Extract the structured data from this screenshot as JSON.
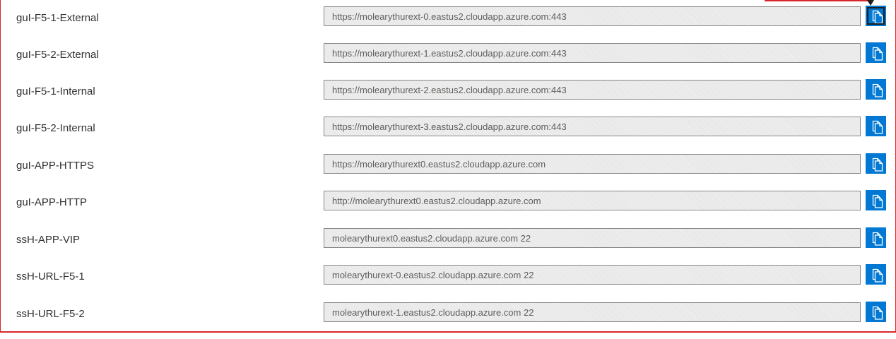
{
  "rows": [
    {
      "label": "guI-F5-1-External",
      "value": "https://molearythurext-0.eastus2.cloudapp.azure.com:443",
      "copy_icon": "copy-icon"
    },
    {
      "label": "guI-F5-2-External",
      "value": "https://molearythurext-1.eastus2.cloudapp.azure.com:443",
      "copy_icon": "copy-icon"
    },
    {
      "label": "guI-F5-1-Internal",
      "value": "https://molearythurext-2.eastus2.cloudapp.azure.com:443",
      "copy_icon": "copy-icon"
    },
    {
      "label": "guI-F5-2-Internal",
      "value": "https://molearythurext-3.eastus2.cloudapp.azure.com:443",
      "copy_icon": "copy-icon"
    },
    {
      "label": "guI-APP-HTTPS",
      "value": "https://molearythurext0.eastus2.cloudapp.azure.com",
      "copy_icon": "copy-icon"
    },
    {
      "label": "guI-APP-HTTP",
      "value": "http://molearythurext0.eastus2.cloudapp.azure.com",
      "copy_icon": "copy-icon"
    },
    {
      "label": "ssH-APP-VIP",
      "value": "molearythurext0.eastus2.cloudapp.azure.com 22",
      "copy_icon": "copy-icon"
    },
    {
      "label": "ssH-URL-F5-1",
      "value": "molearythurext-0.eastus2.cloudapp.azure.com 22",
      "copy_icon": "copy-icon"
    },
    {
      "label": "ssH-URL-F5-2",
      "value": "molearythurext-1.eastus2.cloudapp.azure.com 22",
      "copy_icon": "copy-icon"
    }
  ],
  "colors": {
    "accent": "#0078d4",
    "border": "#d9262b",
    "label_text": "#323130",
    "field_text": "#605e5c"
  }
}
